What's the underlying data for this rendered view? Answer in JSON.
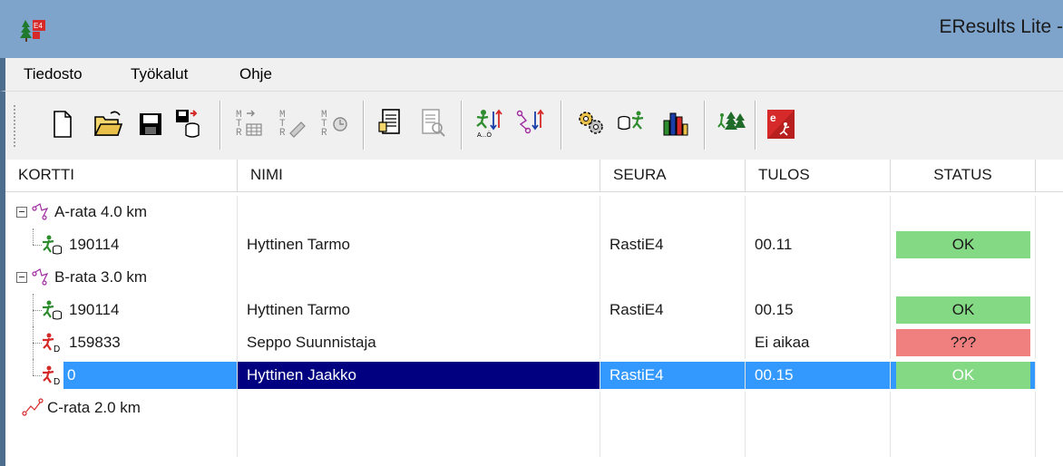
{
  "window": {
    "title": "EResults Lite -"
  },
  "menu": {
    "items": [
      "Tiedosto",
      "Työkalut",
      "Ohje"
    ]
  },
  "toolbar": {
    "buttons": [
      "new-file-icon",
      "open-folder-icon",
      "save-icon",
      "save-to-database-icon",
      "import-table-icon",
      "edit-data-icon",
      "timer-icon",
      "preview-document-icon",
      "print-preview-icon",
      "sort-by-name-icon",
      "sort-by-course-icon",
      "settings-gears-icon",
      "database-runner-icon",
      "bar-chart-icon",
      "forest-runners-icon",
      "eresults-online-icon"
    ]
  },
  "table": {
    "columns": [
      "KORTTI",
      "NIMI",
      "SEURA",
      "TULOS",
      "STATUS"
    ],
    "rows": [
      {
        "type": "course",
        "kortti": "A-rata 4.0 km"
      },
      {
        "type": "runner",
        "kortti": "190114",
        "nimi": "Hyttinen Tarmo",
        "seura": "RastiE4",
        "tulos": "00.11",
        "status": "OK",
        "status_color": "#84d984",
        "icon": "runner-db-icon"
      },
      {
        "type": "course",
        "kortti": "B-rata 3.0 km"
      },
      {
        "type": "runner",
        "kortti": "190114",
        "nimi": "Hyttinen Tarmo",
        "seura": "RastiE4",
        "tulos": "00.15",
        "status": "OK",
        "status_color": "#84d984",
        "icon": "runner-db-icon"
      },
      {
        "type": "runner",
        "kortti": "159833",
        "nimi": "Seppo Suunnistaja",
        "seura": "",
        "tulos": "Ei aikaa",
        "status": "???",
        "status_color": "#f08080",
        "icon": "runner-d-icon"
      },
      {
        "type": "runner",
        "kortti": "0",
        "nimi": "Hyttinen Jaakko",
        "seura": "RastiE4",
        "tulos": "00.15",
        "status": "OK",
        "status_color": "#84d984",
        "icon": "runner-d-icon",
        "selected": true
      },
      {
        "type": "course",
        "kortti": "C-rata 2.0 km"
      }
    ]
  },
  "colors": {
    "titlebar": "#7fa4cc",
    "selection_primary": "#000080",
    "selection_secondary": "#3399ff",
    "ok": "#84d984",
    "error": "#f08080"
  }
}
